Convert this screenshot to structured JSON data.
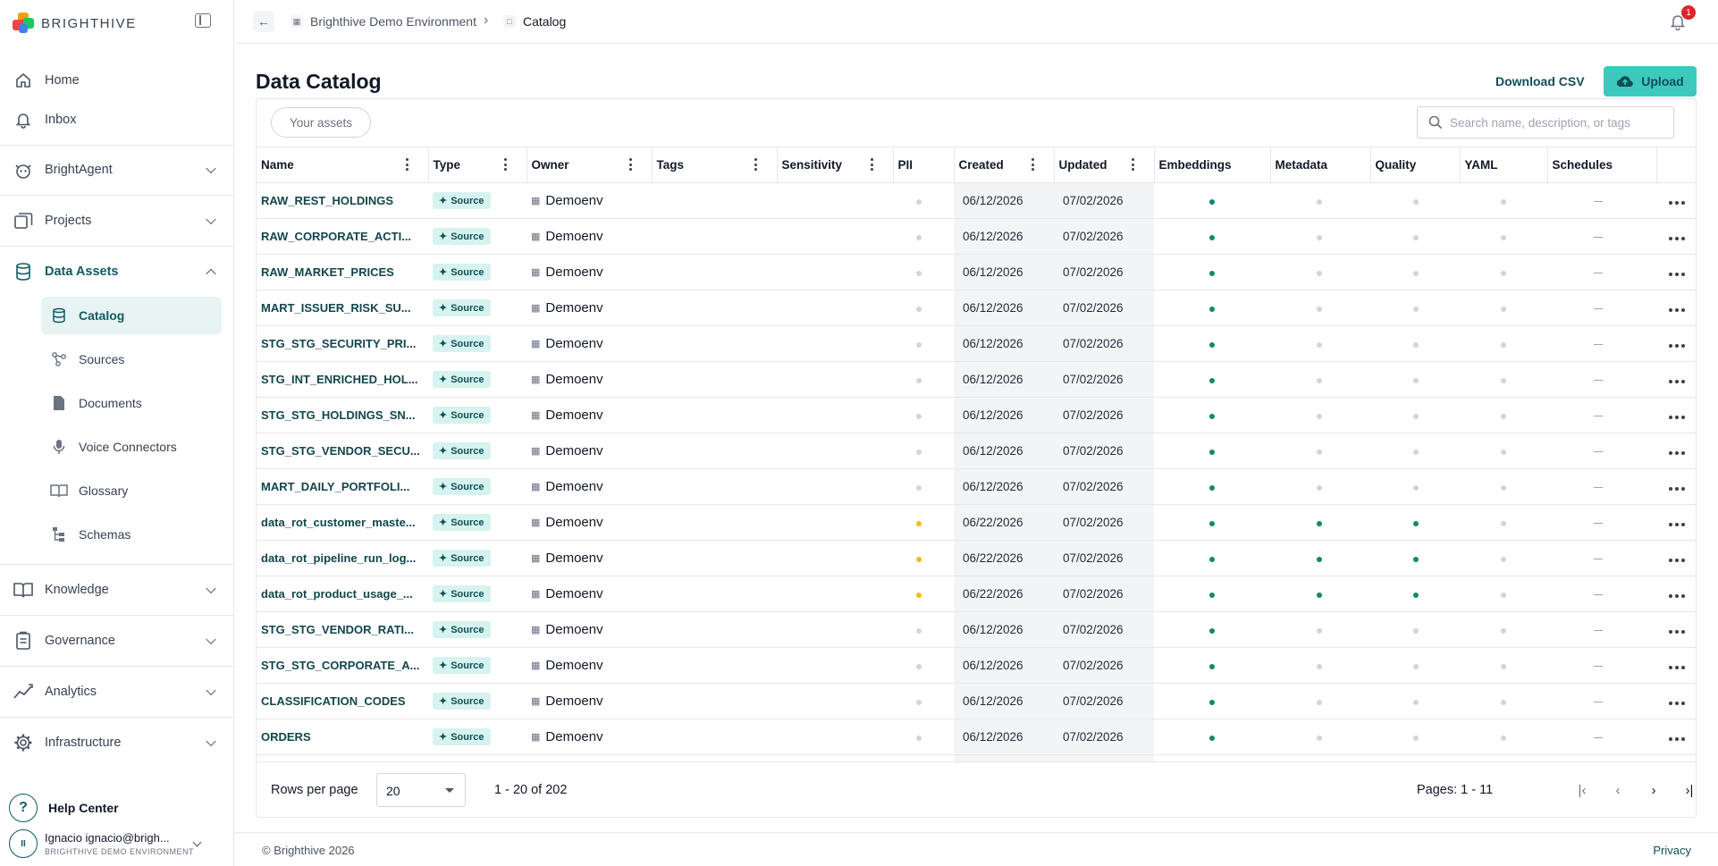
{
  "brand": {
    "name": "BRIGHTHIVE"
  },
  "sidebar": {
    "items": [
      {
        "label": "Home",
        "icon": "home-icon"
      },
      {
        "label": "Inbox",
        "icon": "bell-icon"
      },
      {
        "label": "BrightAgent",
        "icon": "robot-icon"
      },
      {
        "label": "Projects",
        "icon": "folders-icon"
      },
      {
        "label": "Data Assets",
        "icon": "database-icon"
      },
      {
        "label": "Knowledge",
        "icon": "book-icon"
      },
      {
        "label": "Governance",
        "icon": "clipboard-icon"
      },
      {
        "label": "Analytics",
        "icon": "chart-icon"
      },
      {
        "label": "Infrastructure",
        "icon": "gear-icon"
      }
    ],
    "sub_items": [
      {
        "label": "Catalog",
        "icon": "database-icon"
      },
      {
        "label": "Sources",
        "icon": "source-icon"
      },
      {
        "label": "Documents",
        "icon": "document-icon"
      },
      {
        "label": "Voice Connectors",
        "icon": "microphone-icon"
      },
      {
        "label": "Glossary",
        "icon": "glossary-icon"
      },
      {
        "label": "Schemas",
        "icon": "schema-icon"
      }
    ],
    "help": "Help Center",
    "help_glyph": "?",
    "user": {
      "initials": "II",
      "name": "Ignacio ignacio@brigh...",
      "env": "BRIGHTHIVE DEMO ENVIRONMENT"
    }
  },
  "topbar": {
    "crumb_env": "Brighthive Demo Environment",
    "crumb_page": "Catalog",
    "notifications": "1"
  },
  "page": {
    "title": "Data Catalog",
    "download_label": "Download CSV",
    "upload_label": "Upload",
    "assets_filter": "Your assets",
    "search_placeholder": "Search name, description, or tags"
  },
  "table": {
    "columns": [
      "Name",
      "Type",
      "Owner",
      "Tags",
      "Sensitivity",
      "PII",
      "Created",
      "Updated",
      "Embeddings",
      "Metadata",
      "Quality",
      "YAML",
      "Schedules"
    ],
    "rows": [
      {
        "name": "RAW_REST_HOLDINGS",
        "type": "Source",
        "owner": "Demoenv",
        "pii": "none",
        "created": "06/12/2026",
        "updated": "07/02/2026",
        "embeddings": "green",
        "metadata": "grey",
        "quality": "grey",
        "yaml": "grey"
      },
      {
        "name": "RAW_CORPORATE_ACTI...",
        "type": "Source",
        "owner": "Demoenv",
        "pii": "none",
        "created": "06/12/2026",
        "updated": "07/02/2026",
        "embeddings": "green",
        "metadata": "grey",
        "quality": "grey",
        "yaml": "grey"
      },
      {
        "name": "RAW_MARKET_PRICES",
        "type": "Source",
        "owner": "Demoenv",
        "pii": "none",
        "created": "06/12/2026",
        "updated": "07/02/2026",
        "embeddings": "green",
        "metadata": "grey",
        "quality": "grey",
        "yaml": "grey"
      },
      {
        "name": "MART_ISSUER_RISK_SU...",
        "type": "Source",
        "owner": "Demoenv",
        "pii": "none",
        "created": "06/12/2026",
        "updated": "07/02/2026",
        "embeddings": "green",
        "metadata": "grey",
        "quality": "grey",
        "yaml": "grey"
      },
      {
        "name": "STG_STG_SECURITY_PRI...",
        "type": "Source",
        "owner": "Demoenv",
        "pii": "none",
        "created": "06/12/2026",
        "updated": "07/02/2026",
        "embeddings": "green",
        "metadata": "grey",
        "quality": "grey",
        "yaml": "grey"
      },
      {
        "name": "STG_INT_ENRICHED_HOL...",
        "type": "Source",
        "owner": "Demoenv",
        "pii": "none",
        "created": "06/12/2026",
        "updated": "07/02/2026",
        "embeddings": "green",
        "metadata": "grey",
        "quality": "grey",
        "yaml": "grey"
      },
      {
        "name": "STG_STG_HOLDINGS_SN...",
        "type": "Source",
        "owner": "Demoenv",
        "pii": "none",
        "created": "06/12/2026",
        "updated": "07/02/2026",
        "embeddings": "green",
        "metadata": "grey",
        "quality": "grey",
        "yaml": "grey"
      },
      {
        "name": "STG_STG_VENDOR_SECU...",
        "type": "Source",
        "owner": "Demoenv",
        "pii": "none",
        "created": "06/12/2026",
        "updated": "07/02/2026",
        "embeddings": "green",
        "metadata": "grey",
        "quality": "grey",
        "yaml": "grey"
      },
      {
        "name": "MART_DAILY_PORTFOLI...",
        "type": "Source",
        "owner": "Demoenv",
        "pii": "none",
        "created": "06/12/2026",
        "updated": "07/02/2026",
        "embeddings": "green",
        "metadata": "grey",
        "quality": "grey",
        "yaml": "grey"
      },
      {
        "name": "data_rot_customer_maste...",
        "type": "Source",
        "owner": "Demoenv",
        "pii": "amber",
        "created": "06/22/2026",
        "updated": "07/02/2026",
        "embeddings": "green",
        "metadata": "green",
        "quality": "green",
        "yaml": "grey"
      },
      {
        "name": "data_rot_pipeline_run_log...",
        "type": "Source",
        "owner": "Demoenv",
        "pii": "amber",
        "created": "06/22/2026",
        "updated": "07/02/2026",
        "embeddings": "green",
        "metadata": "green",
        "quality": "green",
        "yaml": "grey"
      },
      {
        "name": "data_rot_product_usage_...",
        "type": "Source",
        "owner": "Demoenv",
        "pii": "amber",
        "created": "06/22/2026",
        "updated": "07/02/2026",
        "embeddings": "green",
        "metadata": "green",
        "quality": "green",
        "yaml": "grey"
      },
      {
        "name": "STG_STG_VENDOR_RATI...",
        "type": "Source",
        "owner": "Demoenv",
        "pii": "none",
        "created": "06/12/2026",
        "updated": "07/02/2026",
        "embeddings": "green",
        "metadata": "grey",
        "quality": "grey",
        "yaml": "grey"
      },
      {
        "name": "STG_STG_CORPORATE_A...",
        "type": "Source",
        "owner": "Demoenv",
        "pii": "none",
        "created": "06/12/2026",
        "updated": "07/02/2026",
        "embeddings": "green",
        "metadata": "grey",
        "quality": "grey",
        "yaml": "grey"
      },
      {
        "name": "CLASSIFICATION_CODES",
        "type": "Source",
        "owner": "Demoenv",
        "pii": "none",
        "created": "06/12/2026",
        "updated": "07/02/2026",
        "embeddings": "green",
        "metadata": "grey",
        "quality": "grey",
        "yaml": "grey"
      },
      {
        "name": "ORDERS",
        "type": "Source",
        "owner": "Demoenv",
        "pii": "none",
        "created": "06/12/2026",
        "updated": "07/02/2026",
        "embeddings": "green",
        "metadata": "grey",
        "quality": "grey",
        "yaml": "grey"
      }
    ]
  },
  "pagination": {
    "rows_label": "Rows per page",
    "rows_value": "20",
    "range": "1 - 20 of 202",
    "pages": "Pages: 1 - 11"
  },
  "footer": {
    "copyright": "© Brighthive 2026",
    "privacy": "Privacy"
  },
  "colors": {
    "accent": "#0e5c63",
    "upload": "#3ec9bf",
    "badge": "#dc2626",
    "green_dot": "#0f8a6b",
    "amber_dot": "#f5b921"
  }
}
